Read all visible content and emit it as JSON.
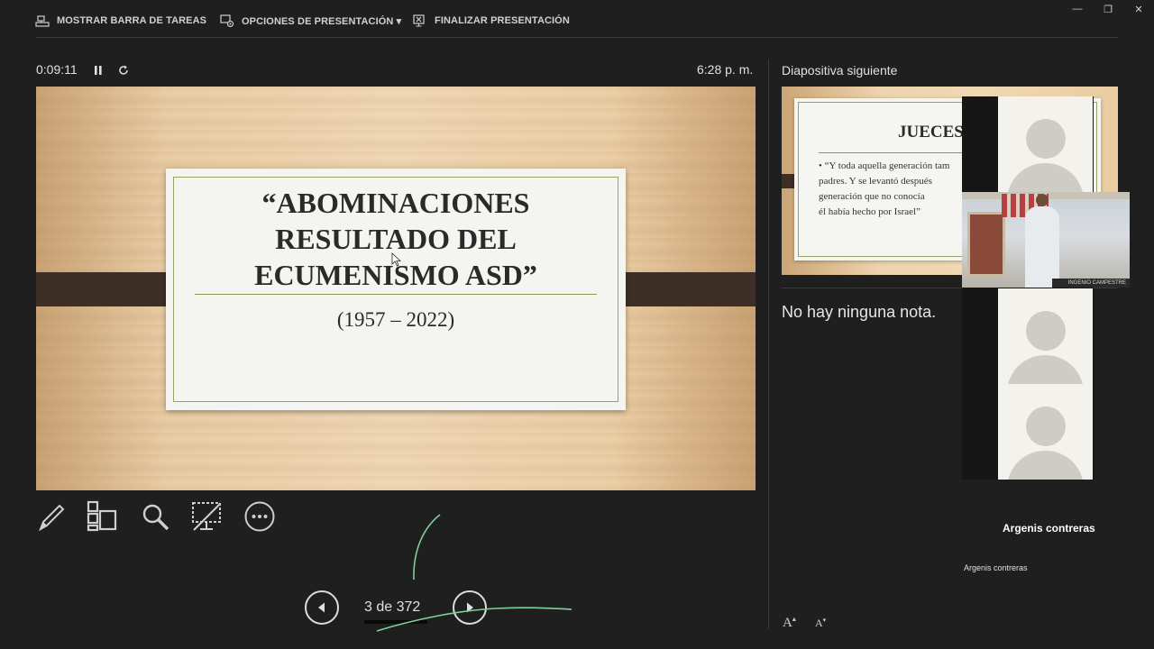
{
  "toolbar": {
    "show_taskbar": "MOSTRAR BARRA DE TAREAS",
    "display_settings": "OPCIONES DE PRESENTACIÓN ▾",
    "end_show": "FINALIZAR PRESENTACIÓN"
  },
  "window_controls": {
    "minimize": "—",
    "restore": "❐",
    "close": "✕"
  },
  "timer": {
    "elapsed": "0:09:11",
    "clock": "6:28 p. m."
  },
  "slide": {
    "title_line1": "“ABOMINACIONES",
    "title_line2": "RESULTADO DEL",
    "title_line3": "ECUMENISMO ASD”",
    "subtitle": "(1957 – 2022)"
  },
  "navigation": {
    "counter": "3 de 372"
  },
  "next_panel": {
    "label": "Diapositiva siguiente",
    "slide_title": "JUECES",
    "bullet_line1": "• “Y toda aquella generación tam",
    "bullet_line2": "padres. Y se levantó después",
    "bullet_line3": "generación que no conocía",
    "bullet_line4": "él había hecho por Israel”"
  },
  "notes": {
    "text": "No hay ninguna nota."
  },
  "font_controls": {
    "increase": "A",
    "decrease": "A"
  },
  "meeting": {
    "speaker_name": "Argenis contreras",
    "self_name": "Argenis contreras",
    "camera_overlay": "INGENIO CAMPESTRE"
  },
  "icons": [
    "taskbar-icon",
    "display-settings-icon",
    "end-show-icon",
    "pause-icon",
    "reset-icon",
    "pen-icon",
    "see-all-slides-icon",
    "zoom-icon",
    "black-screen-icon",
    "more-options-icon",
    "previous-arrow-icon",
    "next-arrow-icon"
  ],
  "colors": {
    "background": "#1f1f1f",
    "slide_bar": "#3d2f26",
    "slide_accent": "#8d9458",
    "annotation": "#7fd19a"
  }
}
